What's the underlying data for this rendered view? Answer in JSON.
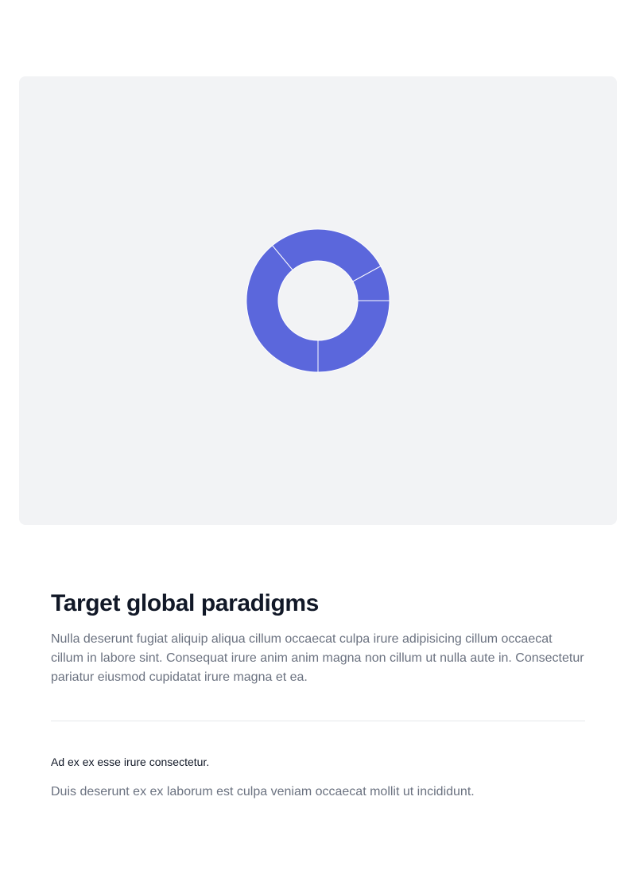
{
  "chart_data": {
    "type": "pie",
    "style": "donut",
    "slices": [
      {
        "value": 25
      },
      {
        "value": 39
      },
      {
        "value": 28
      },
      {
        "value": 8
      }
    ],
    "color": "#5b67dc",
    "background": "#f2f3f5",
    "separator_color": "#ffffff"
  },
  "article": {
    "title": "Target global paradigms",
    "description": "Nulla deserunt fugiat aliquip aliqua cillum occaecat culpa irure adipisicing cillum occaecat cillum in labore sint. Consequat irure anim anim magna non cillum ut nulla aute in. Consectetur pariatur eiusmod cupidatat irure magna et ea.",
    "subheading": "Ad ex ex esse irure consectetur.",
    "subtext": "Duis deserunt ex ex laborum est culpa veniam occaecat mollit ut incididunt."
  }
}
